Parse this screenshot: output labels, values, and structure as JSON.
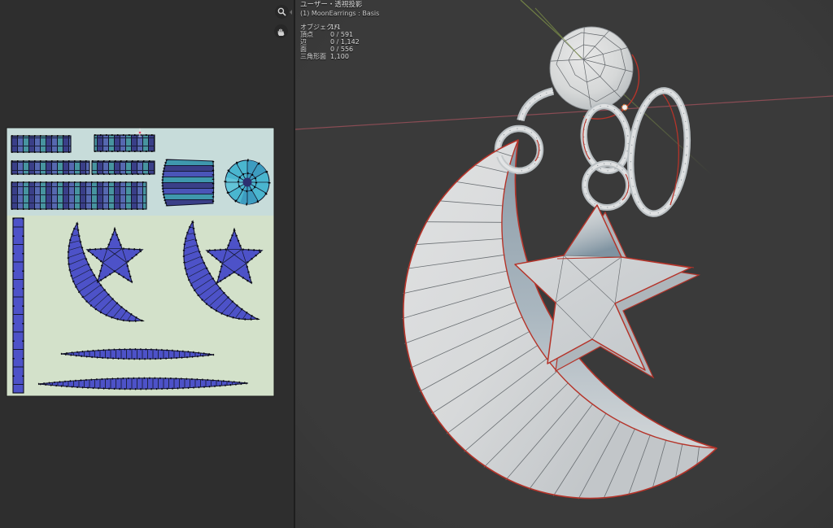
{
  "colors": {
    "viewport_bg": "#3a3a3a",
    "editor_bg": "#2e2e2e",
    "divider": "#1e1e1e",
    "uv_bg_top": "#c7dcda",
    "uv_bg_bottom": "#d3e1ca",
    "uv_island": "#4d52c8",
    "uv_teal": "#47949f",
    "uv_navy": "#3a3f88",
    "uv_cyan": "#4ab6cf",
    "uv_edge": "#10142a",
    "seam": "#b5342a",
    "axis_x": "#8f4e56",
    "axis_y": "#7f9348",
    "model_light": "#dfe1e2",
    "model_mid": "#c0c5c8",
    "model_dark": "#8b9ba7",
    "overlay_text": "#d8d8d8",
    "cursor_orange": "#d46a2a"
  },
  "uv_editor": {
    "tools": [
      {
        "name": "zoom"
      },
      {
        "name": "pan"
      }
    ]
  },
  "viewport_header": {
    "view_label": "ユーザー・透視投影",
    "object_label": "(1) MoonEarrings : Basis",
    "stats": [
      {
        "label": "オブジェクト",
        "value": "1/1"
      },
      {
        "label": "頂点",
        "value": "0 / 591"
      },
      {
        "label": "辺",
        "value": "0 / 1,142"
      },
      {
        "label": "面",
        "value": "0 / 556"
      },
      {
        "label": "三角形面",
        "value": "1,100"
      }
    ]
  }
}
